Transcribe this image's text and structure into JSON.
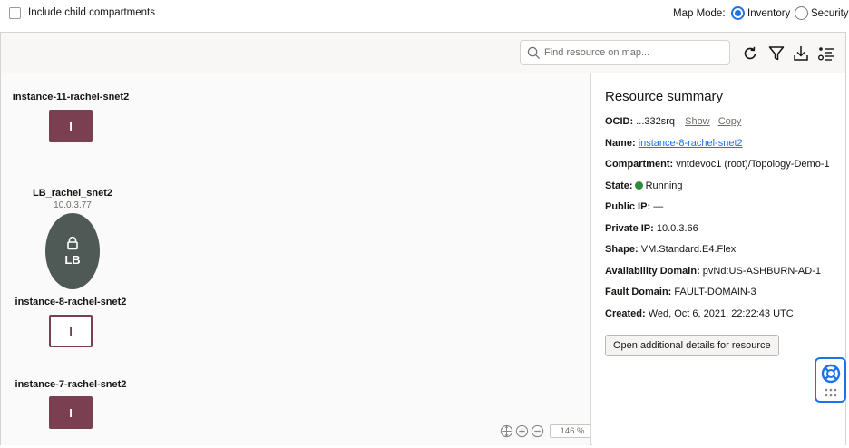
{
  "header": {
    "include_child_label": "Include child compartments",
    "map_mode_label": "Map Mode:",
    "mode_inventory": "Inventory",
    "mode_security": "Security"
  },
  "toolbar": {
    "search_placeholder": "Find resource on map...",
    "icons": [
      "search-icon",
      "refresh-icon",
      "filter-icon",
      "download-icon",
      "legend-icon"
    ]
  },
  "map": {
    "nodes": [
      {
        "label": "instance-11-rachel-snet2",
        "glyph": "I"
      },
      {
        "label": "LB_rachel_snet2",
        "sub": "10.0.3.77",
        "glyph": "LB"
      },
      {
        "label": "instance-8-rachel-snet2",
        "glyph": "I"
      },
      {
        "label": "instance-7-rachel-snet2",
        "glyph": "I"
      }
    ],
    "zoom_level": "146 %"
  },
  "summary": {
    "title": "Resource summary",
    "ocid_label": "OCID:",
    "ocid_value": "...332srq",
    "show": "Show",
    "copy": "Copy",
    "name_label": "Name:",
    "name_value": "instance-8-rachel-snet2",
    "compartment_label": "Compartment:",
    "compartment_value": "vntdevoc1 (root)/Topology-Demo-1",
    "state_label": "State:",
    "state_value": "Running",
    "public_ip_label": "Public IP:",
    "public_ip_value": "—",
    "private_ip_label": "Private IP:",
    "private_ip_value": "10.0.3.66",
    "shape_label": "Shape:",
    "shape_value": "VM.Standard.E4.Flex",
    "ad_label": "Availability Domain:",
    "ad_value": "pvNd:US-ASHBURN-AD-1",
    "fd_label": "Fault Domain:",
    "fd_value": "FAULT-DOMAIN-3",
    "created_label": "Created:",
    "created_value": "Wed, Oct 6, 2021, 22:22:43 UTC",
    "details_button": "Open additional details for resource"
  },
  "colors": {
    "accent": "#1a73e8",
    "instance": "#7a3f50",
    "lb": "#4f5a57",
    "running": "#2e8b3a"
  }
}
